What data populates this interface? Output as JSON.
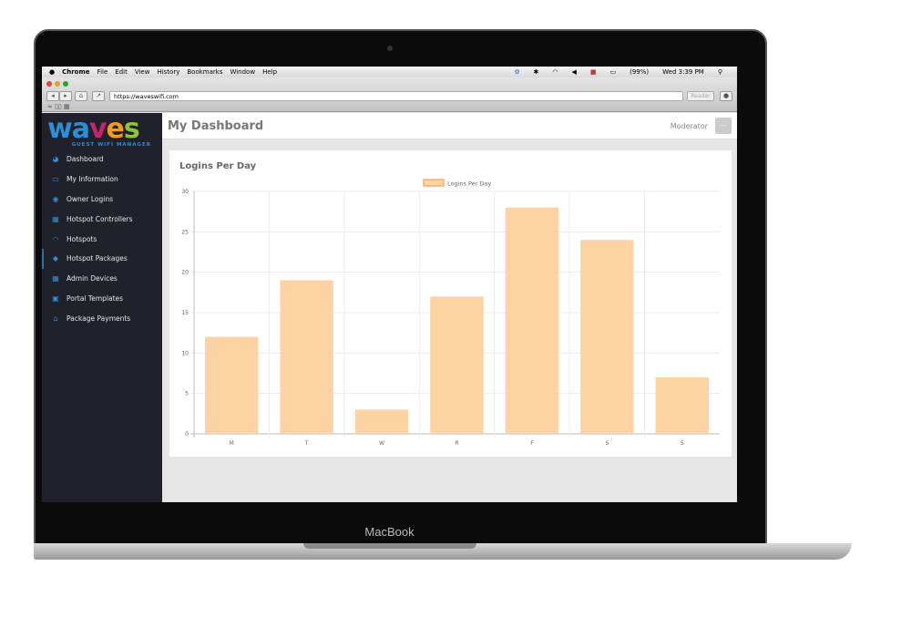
{
  "menubar": {
    "app": "Chrome",
    "items": [
      "File",
      "Edit",
      "View",
      "History",
      "Bookmarks",
      "Window",
      "Help"
    ],
    "battery": "(99%)",
    "clock": "Wed 3:39 PM"
  },
  "browser": {
    "url": "https://waveswifi.com",
    "reader": "Reader"
  },
  "logo": {
    "text": "waves",
    "subtitle": "GUEST WIFI MANAGER"
  },
  "sidebar": {
    "items": [
      {
        "label": "Dashboard",
        "icon": "dashboard-icon",
        "glyph": "◕"
      },
      {
        "label": "My Information",
        "icon": "id-card-icon",
        "glyph": "▭"
      },
      {
        "label": "Owner Logins",
        "icon": "user-circle-icon",
        "glyph": "◉"
      },
      {
        "label": "Hotspot Controllers",
        "icon": "server-icon",
        "glyph": "▦"
      },
      {
        "label": "Hotspots",
        "icon": "wifi-icon",
        "glyph": "◠"
      },
      {
        "label": "Hotspot Packages",
        "icon": "cube-icon",
        "glyph": "◆",
        "active": true
      },
      {
        "label": "Admin Devices",
        "icon": "server-icon",
        "glyph": "▦"
      },
      {
        "label": "Portal Templates",
        "icon": "image-icon",
        "glyph": "▣"
      },
      {
        "label": "Package Payments",
        "icon": "home-icon",
        "glyph": "⌂"
      }
    ]
  },
  "header": {
    "title": "My Dashboard",
    "user": "Moderator",
    "menu_button": "—"
  },
  "card": {
    "title": "Logins Per Day"
  },
  "laptop": {
    "brand": "MacBook"
  },
  "chart_data": {
    "type": "bar",
    "title": "",
    "categories": [
      "M",
      "T",
      "W",
      "R",
      "F",
      "S",
      "S"
    ],
    "series": [
      {
        "name": "Logins Per Day",
        "values": [
          12,
          19,
          3,
          17,
          28,
          24,
          7
        ]
      }
    ],
    "ylim": [
      0,
      30
    ],
    "yticks": [
      0,
      5,
      10,
      15,
      20,
      25,
      30
    ],
    "grid": true,
    "legend": "top-center",
    "colors": {
      "fill": "#fdd3a3",
      "border": "#f7a35c"
    }
  }
}
